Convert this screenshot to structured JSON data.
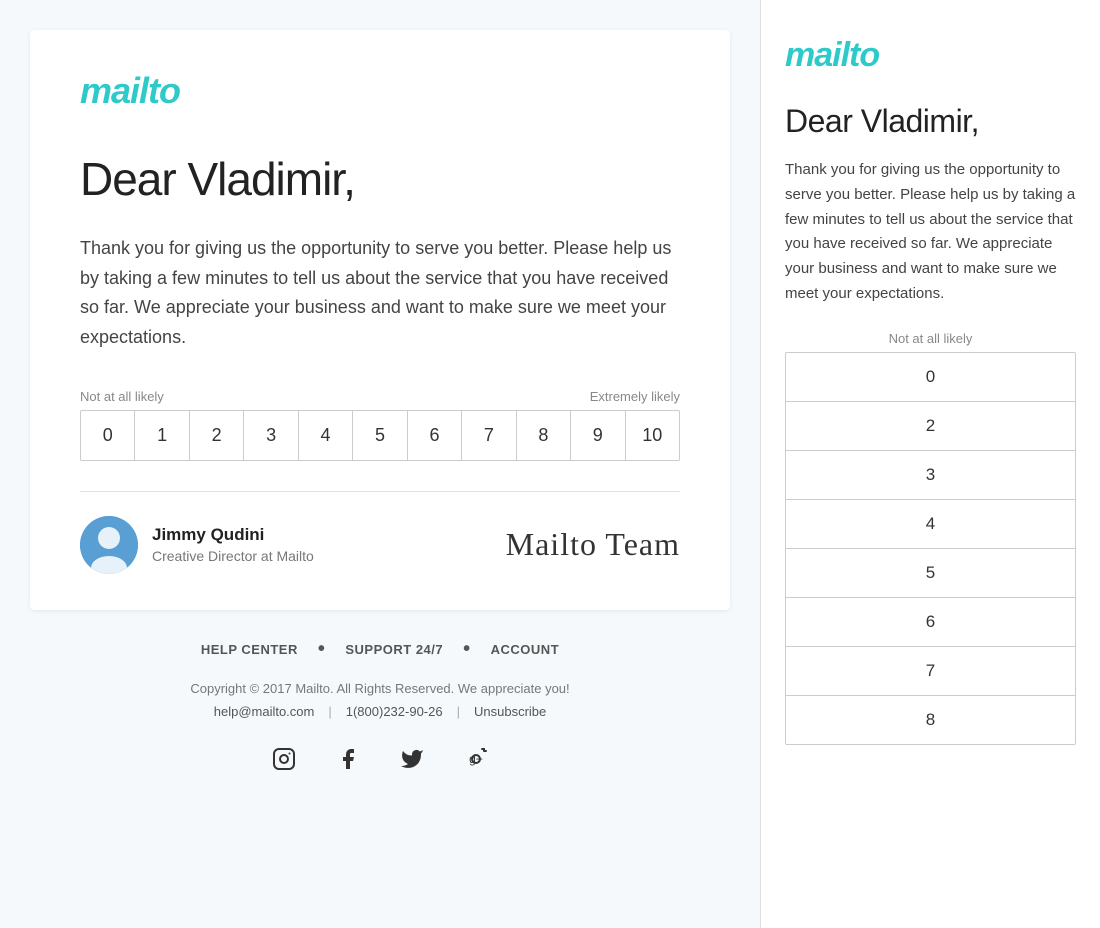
{
  "left": {
    "logo": "mailto",
    "greeting": "Dear Vladimir,",
    "body_text": "Thank you for giving us the opportunity to serve you better. Please help us by taking a few minutes to tell us about the service that you have received so far. We appreciate your business and want to make sure we meet your expectations.",
    "scale": {
      "label_left": "Not at all likely",
      "label_right": "Extremely likely",
      "values": [
        "0",
        "1",
        "2",
        "3",
        "4",
        "5",
        "6",
        "7",
        "8",
        "9",
        "10"
      ]
    },
    "sender": {
      "name": "Jimmy Qudini",
      "title": "Creative Director at Mailto",
      "signature": "Mailto Team"
    },
    "footer": {
      "nav_items": [
        "HELP CENTER",
        "SUPPORT 24/7",
        "ACCOUNT"
      ],
      "copyright": "Copyright © 2017 Mailto. All Rights Reserved. We appreciate you!",
      "email": "help@mailto.com",
      "phone": "1(800)232-90-26",
      "unsubscribe": "Unsubscribe",
      "social": [
        "instagram-icon",
        "facebook-icon",
        "twitter-icon",
        "google-plus-icon"
      ]
    }
  },
  "right": {
    "logo": "mailto",
    "greeting": "Dear Vladimir,",
    "body_text": "Thank you for giving us the opportunity to serve you better. Please help us by taking a few minutes to tell us about the service that you have received so far. We appreciate your business and want to make sure we meet your expectations.",
    "scale": {
      "label": "Not at all likely",
      "values": [
        "0",
        "2",
        "3",
        "4",
        "5",
        "6",
        "7",
        "8"
      ]
    }
  }
}
